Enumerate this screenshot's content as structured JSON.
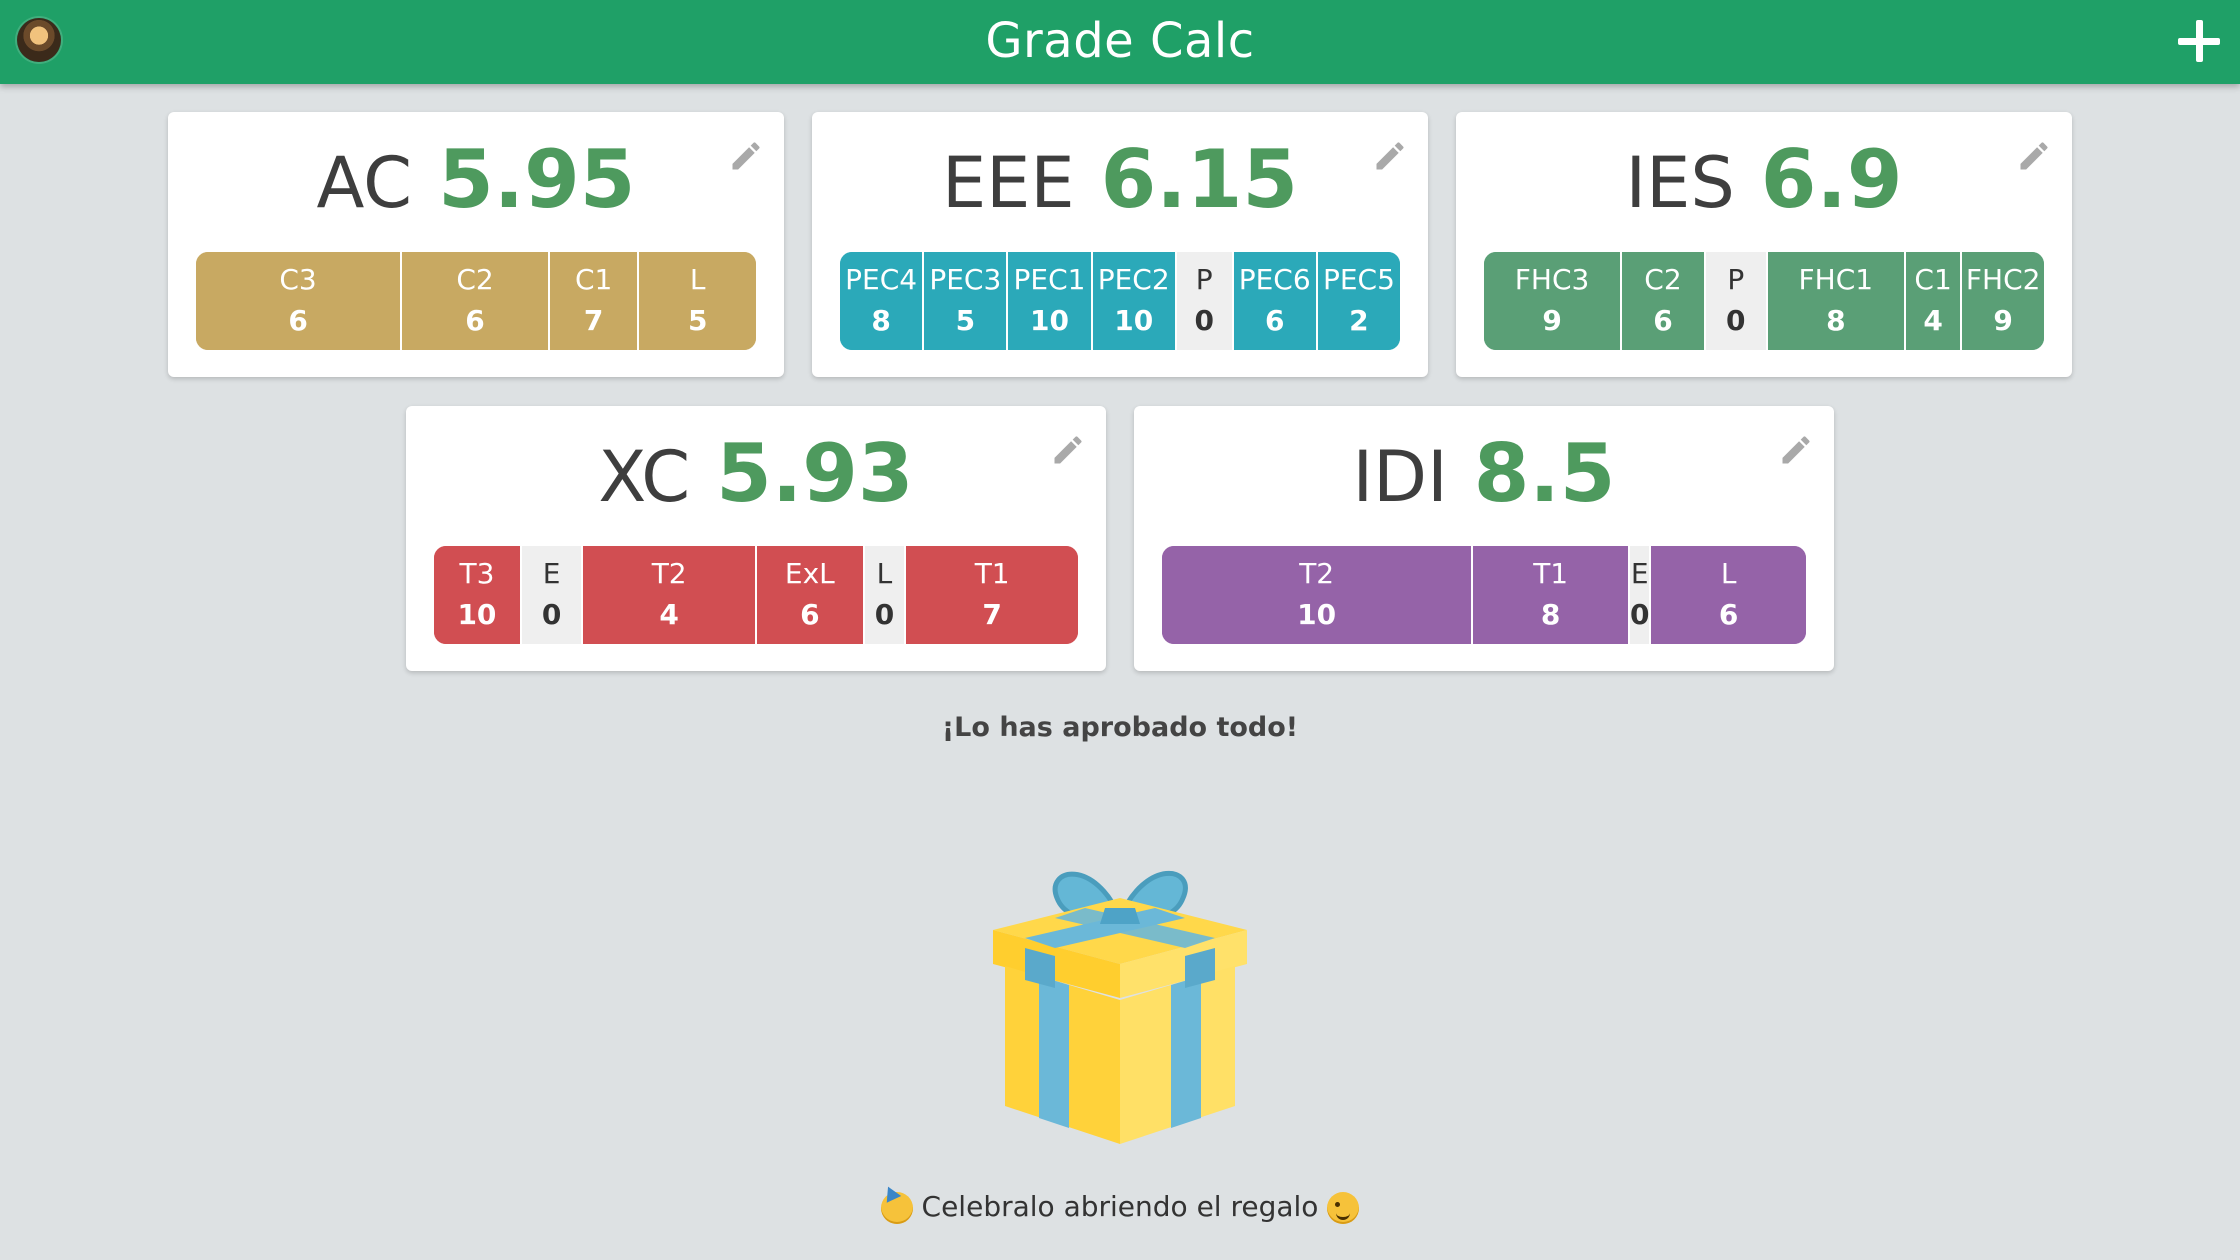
{
  "app": {
    "title": "Grade Calc"
  },
  "subjects": [
    {
      "name": "AC",
      "average": "5.95",
      "color": "#c8a962",
      "grades": [
        {
          "label": "C3",
          "value": "6",
          "weight": 35
        },
        {
          "label": "C2",
          "value": "6",
          "weight": 25
        },
        {
          "label": "C1",
          "value": "7",
          "weight": 15
        },
        {
          "label": "L",
          "value": "5",
          "weight": 20
        }
      ]
    },
    {
      "name": "EEE",
      "average": "6.15",
      "color": "#2ba9b9",
      "grades": [
        {
          "label": "PEC4",
          "value": "8",
          "weight": 15
        },
        {
          "label": "PEC3",
          "value": "5",
          "weight": 15
        },
        {
          "label": "PEC1",
          "value": "10",
          "weight": 15
        },
        {
          "label": "PEC2",
          "value": "10",
          "weight": 15
        },
        {
          "label": "P",
          "value": "0",
          "weight": 10
        },
        {
          "label": "PEC6",
          "value": "6",
          "weight": 15
        },
        {
          "label": "PEC5",
          "value": "2",
          "weight": 15
        }
      ]
    },
    {
      "name": "IES",
      "average": "6.9",
      "color": "#5a9f76",
      "grades": [
        {
          "label": "FHC3",
          "value": "9",
          "weight": 25
        },
        {
          "label": "C2",
          "value": "6",
          "weight": 15
        },
        {
          "label": "P",
          "value": "0",
          "weight": 11
        },
        {
          "label": "FHC1",
          "value": "8",
          "weight": 25
        },
        {
          "label": "C1",
          "value": "4",
          "weight": 10
        },
        {
          "label": "FHC2",
          "value": "9",
          "weight": 15
        }
      ]
    },
    {
      "name": "XC",
      "average": "5.93",
      "color": "#d14e52",
      "grades": [
        {
          "label": "T3",
          "value": "10",
          "weight": 13
        },
        {
          "label": "E",
          "value": "0",
          "weight": 9
        },
        {
          "label": "T2",
          "value": "4",
          "weight": 26
        },
        {
          "label": "ExL",
          "value": "6",
          "weight": 16
        },
        {
          "label": "L",
          "value": "0",
          "weight": 6
        },
        {
          "label": "T1",
          "value": "7",
          "weight": 26
        }
      ]
    },
    {
      "name": "IDI",
      "average": "8.5",
      "color": "#9563a8",
      "grades": [
        {
          "label": "T2",
          "value": "10",
          "weight": 48
        },
        {
          "label": "T1",
          "value": "8",
          "weight": 24
        },
        {
          "label": "E",
          "value": "0",
          "weight": 3
        },
        {
          "label": "L",
          "value": "6",
          "weight": 24
        }
      ]
    }
  ],
  "message": "¡Lo has aprobado todo!",
  "celebrate_text": "Celebralo abriendo el regalo",
  "icons": {
    "avatar": "avatar-image",
    "add": "plus-icon",
    "edit": "pencil-icon",
    "gift": "gift-icon",
    "party": "party-face-emoji",
    "wink": "wink-face-emoji"
  }
}
